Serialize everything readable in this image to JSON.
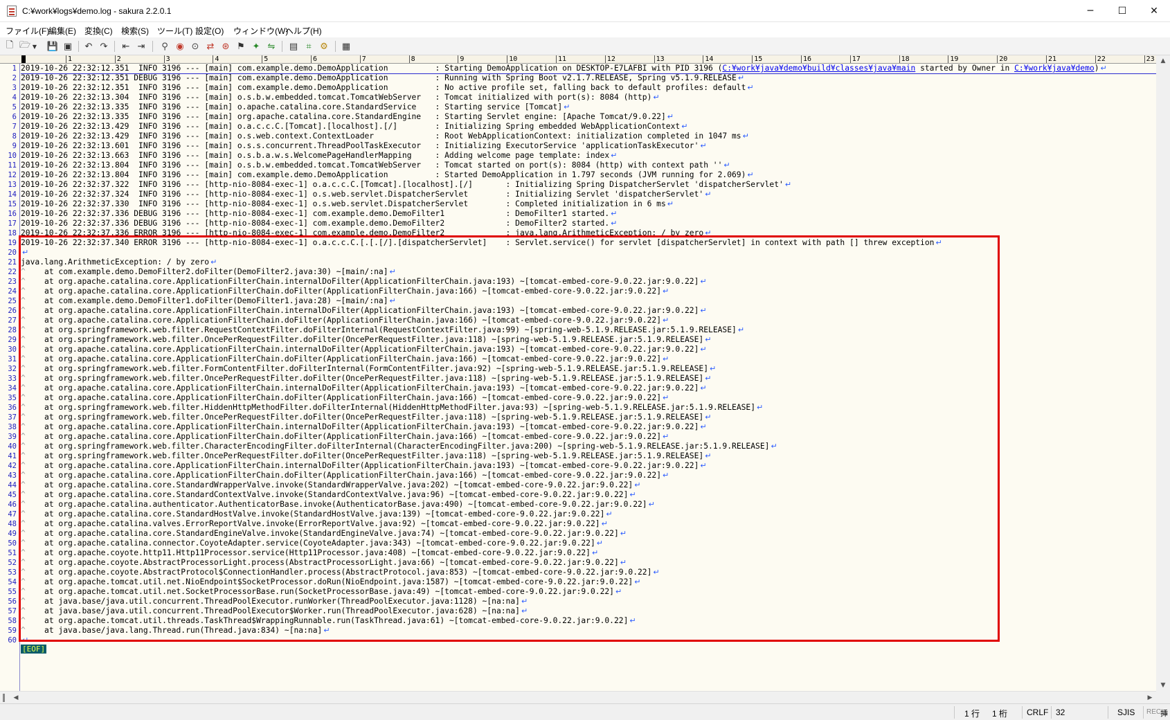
{
  "window": {
    "title": "C:¥work¥logs¥demo.log - sakura 2.2.0.1",
    "minimize_glyph": "─",
    "maximize_glyph": "☐",
    "close_glyph": "✕"
  },
  "menu": [
    "ファイル(F)",
    "編集(E)",
    "変換(C)",
    "検索(S)",
    "ツール(T)",
    "設定(O)",
    "ウィンドウ(W)",
    "ヘルプ(H)"
  ],
  "toolbar": {
    "icons": [
      "new-file-icon",
      "open-file-icon",
      "dropdown-icon",
      "save-icon",
      "save-all-icon",
      "undo-icon",
      "redo-icon",
      "back-icon",
      "forward-icon",
      "search-icon",
      "search-prev-icon",
      "search-next-icon",
      "replace-icon",
      "grep-icon",
      "bookmark-icon",
      "find-mark-icon",
      "compare-icon",
      "outline-icon",
      "tag-jump-icon",
      "settings-icon"
    ]
  },
  "ruler": [
    "1",
    "2",
    "3",
    "4",
    "5",
    "6",
    "7",
    "8",
    "9",
    "10",
    "11",
    "12",
    "13",
    "14",
    "15",
    "16",
    "17",
    "18",
    "19",
    "20",
    "21",
    "22",
    "23"
  ],
  "lines": [
    {
      "n": "1",
      "t": "2019-10-26 22:32:12.351  INFO 3196 --- [main] com.example.demo.DemoApplication          : Starting DemoApplication on DESKTOP-E7LAFBI with PID 3196 (",
      "link1": "C:¥work¥java¥demo¥build¥classes¥java¥main",
      "mid": " started by Owner in ",
      "link2": "C:¥work¥java¥demo",
      "tail": ")"
    },
    {
      "n": "2",
      "t": "2019-10-26 22:32:12.351 DEBUG 3196 --- [main] com.example.demo.DemoApplication          : Running with Spring Boot v2.1.7.RELEASE, Spring v5.1.9.RELEASE"
    },
    {
      "n": "3",
      "t": "2019-10-26 22:32:12.351  INFO 3196 --- [main] com.example.demo.DemoApplication          : No active profile set, falling back to default profiles: default"
    },
    {
      "n": "4",
      "t": "2019-10-26 22:32:13.304  INFO 3196 --- [main] o.s.b.w.embedded.tomcat.TomcatWebServer   : Tomcat initialized with port(s): 8084 (http)"
    },
    {
      "n": "5",
      "t": "2019-10-26 22:32:13.335  INFO 3196 --- [main] o.apache.catalina.core.StandardService    : Starting service [Tomcat]"
    },
    {
      "n": "6",
      "t": "2019-10-26 22:32:13.335  INFO 3196 --- [main] org.apache.catalina.core.StandardEngine   : Starting Servlet engine: [Apache Tomcat/9.0.22]"
    },
    {
      "n": "7",
      "t": "2019-10-26 22:32:13.429  INFO 3196 --- [main] o.a.c.c.C.[Tomcat].[localhost].[/]        : Initializing Spring embedded WebApplicationContext"
    },
    {
      "n": "8",
      "t": "2019-10-26 22:32:13.429  INFO 3196 --- [main] o.s.web.context.ContextLoader             : Root WebApplicationContext: initialization completed in 1047 ms"
    },
    {
      "n": "9",
      "t": "2019-10-26 22:32:13.601  INFO 3196 --- [main] o.s.s.concurrent.ThreadPoolTaskExecutor   : Initializing ExecutorService 'applicationTaskExecutor'"
    },
    {
      "n": "10",
      "t": "2019-10-26 22:32:13.663  INFO 3196 --- [main] o.s.b.a.w.s.WelcomePageHandlerMapping     : Adding welcome page template: index"
    },
    {
      "n": "11",
      "t": "2019-10-26 22:32:13.804  INFO 3196 --- [main] o.s.b.w.embedded.tomcat.TomcatWebServer   : Tomcat started on port(s): 8084 (http) with context path ''"
    },
    {
      "n": "12",
      "t": "2019-10-26 22:32:13.804  INFO 3196 --- [main] com.example.demo.DemoApplication          : Started DemoApplication in 1.797 seconds (JVM running for 2.069)"
    },
    {
      "n": "13",
      "t": "2019-10-26 22:32:37.322  INFO 3196 --- [http-nio-8084-exec-1] o.a.c.c.C.[Tomcat].[localhost].[/]       : Initializing Spring DispatcherServlet 'dispatcherServlet'"
    },
    {
      "n": "14",
      "t": "2019-10-26 22:32:37.324  INFO 3196 --- [http-nio-8084-exec-1] o.s.web.servlet.DispatcherServlet        : Initializing Servlet 'dispatcherServlet'"
    },
    {
      "n": "15",
      "t": "2019-10-26 22:32:37.330  INFO 3196 --- [http-nio-8084-exec-1] o.s.web.servlet.DispatcherServlet        : Completed initialization in 6 ms"
    },
    {
      "n": "16",
      "t": "2019-10-26 22:32:37.336 DEBUG 3196 --- [http-nio-8084-exec-1] com.example.demo.DemoFilter1             : DemoFilter1 started."
    },
    {
      "n": "17",
      "t": "2019-10-26 22:32:37.336 DEBUG 3196 --- [http-nio-8084-exec-1] com.example.demo.DemoFilter2             : DemoFilter2 started."
    },
    {
      "n": "18",
      "t": "2019-10-26 22:32:37.336 ERROR 3196 --- [http-nio-8084-exec-1] com.example.demo.DemoFilter2             : java.lang.ArithmeticException: / by zero"
    },
    {
      "n": "19",
      "t": "2019-10-26 22:32:37.340 ERROR 3196 --- [http-nio-8084-exec-1] o.a.c.c.C.[.[.[/].[dispatcherServlet]    : Servlet.service() for servlet [dispatcherServlet] in context with path [] threw exception"
    },
    {
      "n": "20",
      "t": ""
    },
    {
      "n": "21",
      "t": "java.lang.ArithmeticException: / by zero"
    },
    {
      "n": "22",
      "tab": true,
      "t": "at com.example.demo.DemoFilter2.doFilter(DemoFilter2.java:30) ~[main/:na]"
    },
    {
      "n": "23",
      "tab": true,
      "t": "at org.apache.catalina.core.ApplicationFilterChain.internalDoFilter(ApplicationFilterChain.java:193) ~[tomcat-embed-core-9.0.22.jar:9.0.22]"
    },
    {
      "n": "24",
      "tab": true,
      "t": "at org.apache.catalina.core.ApplicationFilterChain.doFilter(ApplicationFilterChain.java:166) ~[tomcat-embed-core-9.0.22.jar:9.0.22]"
    },
    {
      "n": "25",
      "tab": true,
      "t": "at com.example.demo.DemoFilter1.doFilter(DemoFilter1.java:28) ~[main/:na]"
    },
    {
      "n": "26",
      "tab": true,
      "t": "at org.apache.catalina.core.ApplicationFilterChain.internalDoFilter(ApplicationFilterChain.java:193) ~[tomcat-embed-core-9.0.22.jar:9.0.22]"
    },
    {
      "n": "27",
      "tab": true,
      "t": "at org.apache.catalina.core.ApplicationFilterChain.doFilter(ApplicationFilterChain.java:166) ~[tomcat-embed-core-9.0.22.jar:9.0.22]"
    },
    {
      "n": "28",
      "tab": true,
      "t": "at org.springframework.web.filter.RequestContextFilter.doFilterInternal(RequestContextFilter.java:99) ~[spring-web-5.1.9.RELEASE.jar:5.1.9.RELEASE]"
    },
    {
      "n": "29",
      "tab": true,
      "t": "at org.springframework.web.filter.OncePerRequestFilter.doFilter(OncePerRequestFilter.java:118) ~[spring-web-5.1.9.RELEASE.jar:5.1.9.RELEASE]"
    },
    {
      "n": "30",
      "tab": true,
      "t": "at org.apache.catalina.core.ApplicationFilterChain.internalDoFilter(ApplicationFilterChain.java:193) ~[tomcat-embed-core-9.0.22.jar:9.0.22]"
    },
    {
      "n": "31",
      "tab": true,
      "t": "at org.apache.catalina.core.ApplicationFilterChain.doFilter(ApplicationFilterChain.java:166) ~[tomcat-embed-core-9.0.22.jar:9.0.22]"
    },
    {
      "n": "32",
      "tab": true,
      "t": "at org.springframework.web.filter.FormContentFilter.doFilterInternal(FormContentFilter.java:92) ~[spring-web-5.1.9.RELEASE.jar:5.1.9.RELEASE]"
    },
    {
      "n": "33",
      "tab": true,
      "t": "at org.springframework.web.filter.OncePerRequestFilter.doFilter(OncePerRequestFilter.java:118) ~[spring-web-5.1.9.RELEASE.jar:5.1.9.RELEASE]"
    },
    {
      "n": "34",
      "tab": true,
      "t": "at org.apache.catalina.core.ApplicationFilterChain.internalDoFilter(ApplicationFilterChain.java:193) ~[tomcat-embed-core-9.0.22.jar:9.0.22]"
    },
    {
      "n": "35",
      "tab": true,
      "t": "at org.apache.catalina.core.ApplicationFilterChain.doFilter(ApplicationFilterChain.java:166) ~[tomcat-embed-core-9.0.22.jar:9.0.22]"
    },
    {
      "n": "36",
      "tab": true,
      "t": "at org.springframework.web.filter.HiddenHttpMethodFilter.doFilterInternal(HiddenHttpMethodFilter.java:93) ~[spring-web-5.1.9.RELEASE.jar:5.1.9.RELEASE]"
    },
    {
      "n": "37",
      "tab": true,
      "t": "at org.springframework.web.filter.OncePerRequestFilter.doFilter(OncePerRequestFilter.java:118) ~[spring-web-5.1.9.RELEASE.jar:5.1.9.RELEASE]"
    },
    {
      "n": "38",
      "tab": true,
      "t": "at org.apache.catalina.core.ApplicationFilterChain.internalDoFilter(ApplicationFilterChain.java:193) ~[tomcat-embed-core-9.0.22.jar:9.0.22]"
    },
    {
      "n": "39",
      "tab": true,
      "t": "at org.apache.catalina.core.ApplicationFilterChain.doFilter(ApplicationFilterChain.java:166) ~[tomcat-embed-core-9.0.22.jar:9.0.22]"
    },
    {
      "n": "40",
      "tab": true,
      "t": "at org.springframework.web.filter.CharacterEncodingFilter.doFilterInternal(CharacterEncodingFilter.java:200) ~[spring-web-5.1.9.RELEASE.jar:5.1.9.RELEASE]"
    },
    {
      "n": "41",
      "tab": true,
      "t": "at org.springframework.web.filter.OncePerRequestFilter.doFilter(OncePerRequestFilter.java:118) ~[spring-web-5.1.9.RELEASE.jar:5.1.9.RELEASE]"
    },
    {
      "n": "42",
      "tab": true,
      "t": "at org.apache.catalina.core.ApplicationFilterChain.internalDoFilter(ApplicationFilterChain.java:193) ~[tomcat-embed-core-9.0.22.jar:9.0.22]"
    },
    {
      "n": "43",
      "tab": true,
      "t": "at org.apache.catalina.core.ApplicationFilterChain.doFilter(ApplicationFilterChain.java:166) ~[tomcat-embed-core-9.0.22.jar:9.0.22]"
    },
    {
      "n": "44",
      "tab": true,
      "t": "at org.apache.catalina.core.StandardWrapperValve.invoke(StandardWrapperValve.java:202) ~[tomcat-embed-core-9.0.22.jar:9.0.22]"
    },
    {
      "n": "45",
      "tab": true,
      "t": "at org.apache.catalina.core.StandardContextValve.invoke(StandardContextValve.java:96) ~[tomcat-embed-core-9.0.22.jar:9.0.22]"
    },
    {
      "n": "46",
      "tab": true,
      "t": "at org.apache.catalina.authenticator.AuthenticatorBase.invoke(AuthenticatorBase.java:490) ~[tomcat-embed-core-9.0.22.jar:9.0.22]"
    },
    {
      "n": "47",
      "tab": true,
      "t": "at org.apache.catalina.core.StandardHostValve.invoke(StandardHostValve.java:139) ~[tomcat-embed-core-9.0.22.jar:9.0.22]"
    },
    {
      "n": "48",
      "tab": true,
      "t": "at org.apache.catalina.valves.ErrorReportValve.invoke(ErrorReportValve.java:92) ~[tomcat-embed-core-9.0.22.jar:9.0.22]"
    },
    {
      "n": "49",
      "tab": true,
      "t": "at org.apache.catalina.core.StandardEngineValve.invoke(StandardEngineValve.java:74) ~[tomcat-embed-core-9.0.22.jar:9.0.22]"
    },
    {
      "n": "50",
      "tab": true,
      "t": "at org.apache.catalina.connector.CoyoteAdapter.service(CoyoteAdapter.java:343) ~[tomcat-embed-core-9.0.22.jar:9.0.22]"
    },
    {
      "n": "51",
      "tab": true,
      "t": "at org.apache.coyote.http11.Http11Processor.service(Http11Processor.java:408) ~[tomcat-embed-core-9.0.22.jar:9.0.22]"
    },
    {
      "n": "52",
      "tab": true,
      "t": "at org.apache.coyote.AbstractProcessorLight.process(AbstractProcessorLight.java:66) ~[tomcat-embed-core-9.0.22.jar:9.0.22]"
    },
    {
      "n": "53",
      "tab": true,
      "t": "at org.apache.coyote.AbstractProtocol$ConnectionHandler.process(AbstractProtocol.java:853) ~[tomcat-embed-core-9.0.22.jar:9.0.22]"
    },
    {
      "n": "54",
      "tab": true,
      "t": "at org.apache.tomcat.util.net.NioEndpoint$SocketProcessor.doRun(NioEndpoint.java:1587) ~[tomcat-embed-core-9.0.22.jar:9.0.22]"
    },
    {
      "n": "55",
      "tab": true,
      "t": "at org.apache.tomcat.util.net.SocketProcessorBase.run(SocketProcessorBase.java:49) ~[tomcat-embed-core-9.0.22.jar:9.0.22]"
    },
    {
      "n": "56",
      "tab": true,
      "t": "at java.base/java.util.concurrent.ThreadPoolExecutor.runWorker(ThreadPoolExecutor.java:1128) ~[na:na]"
    },
    {
      "n": "57",
      "tab": true,
      "t": "at java.base/java.util.concurrent.ThreadPoolExecutor$Worker.run(ThreadPoolExecutor.java:628) ~[na:na]"
    },
    {
      "n": "58",
      "tab": true,
      "t": "at org.apache.tomcat.util.threads.TaskThread$WrappingRunnable.run(TaskThread.java:61) ~[tomcat-embed-core-9.0.22.jar:9.0.22]"
    },
    {
      "n": "59",
      "tab": true,
      "t": "at java.base/java.lang.Thread.run(Thread.java:834) ~[na:na]"
    },
    {
      "n": "60",
      "t": ""
    }
  ],
  "eof": "[EOF]",
  "glyphs": {
    "crlf": "↵",
    "tab": "^",
    "scroll_up": "▲",
    "scroll_down": "▼",
    "scroll_left": "◀",
    "scroll_right": "▶"
  },
  "status": {
    "row": "1 行",
    "col": "1 桁",
    "eol": "CRLF",
    "code": "32",
    "encoding": "SJIS",
    "rec": "REC",
    "mode": "挿入"
  },
  "colors": {
    "highlight_border": "#e00000",
    "line_number": "#2020c0",
    "link": "#0000ee",
    "crlf_mark": "#2a5bff",
    "editor_bg": "#fdfbf2",
    "eof_bg": "#0a5c6a",
    "eof_fg": "#e9ff4a"
  }
}
